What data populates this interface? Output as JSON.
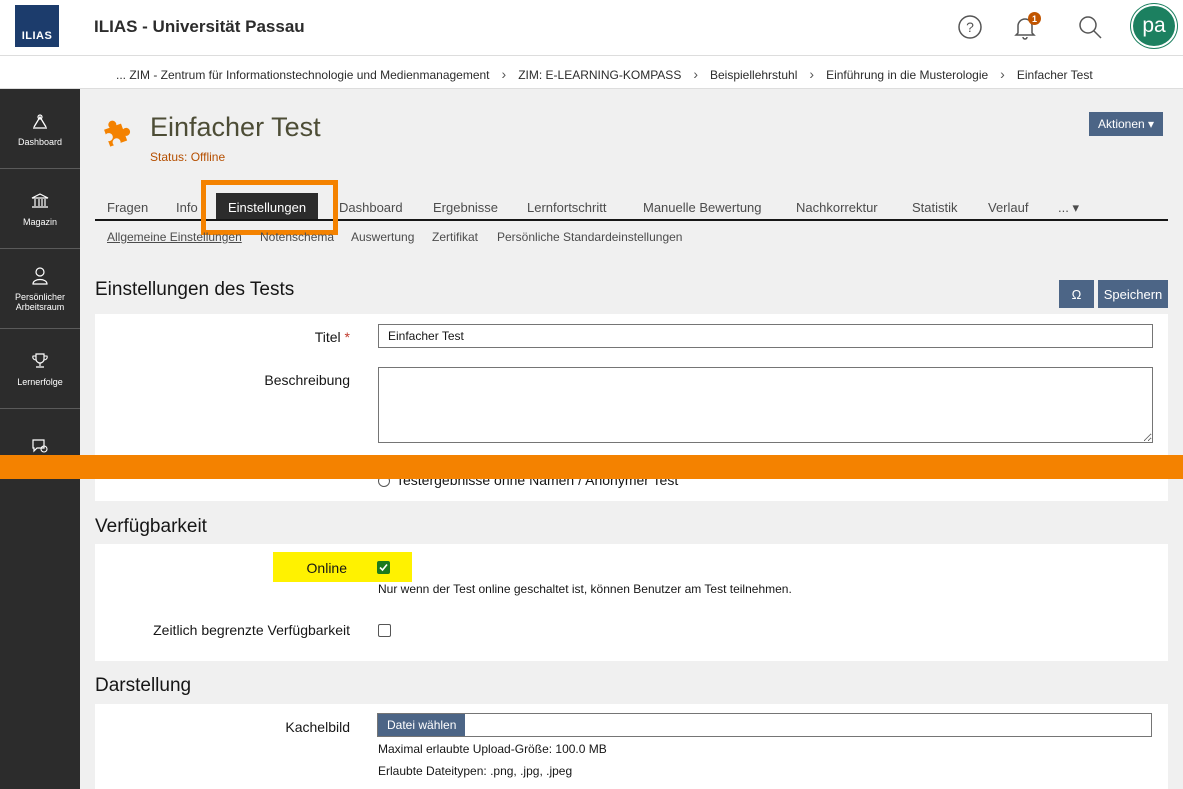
{
  "header": {
    "logo_text": "ILIAS",
    "app_title": "ILIAS - Universität Passau",
    "help_icon": "help-circle-icon",
    "notification_icon": "bell-icon",
    "notification_count": "1",
    "search_icon": "search-icon",
    "avatar_initials": "pa",
    "avatar_color": "#1c8060"
  },
  "breadcrumb": [
    "... ZIM - Zentrum für Informationstechnologie und Medienmanagement",
    "ZIM: E-LEARNING-KOMPASS",
    "Beispiellehrstuhl",
    "Einführung in die Musterologie",
    "Einfacher Test"
  ],
  "sidebar": [
    {
      "label": "Dashboard",
      "icon": "dashboard-icon"
    },
    {
      "label": "Magazin",
      "icon": "magazine-icon"
    },
    {
      "label": "Persönlicher Arbeitsraum",
      "icon": "person-icon"
    },
    {
      "label": "Lernerfolge",
      "icon": "trophy-icon"
    },
    {
      "label": "",
      "icon": "chat-icon"
    }
  ],
  "object": {
    "title": "Einfacher Test",
    "status": "Status: Offline",
    "icon": "puzzle-icon",
    "actions_label": "Aktionen ▾"
  },
  "tabs": [
    "Fragen",
    "Info",
    "Einstellungen",
    "Dashboard",
    "Ergebnisse",
    "Lernfortschritt",
    "Manuelle Bewertung",
    "Nachkorrektur",
    "Statistik",
    "Verlauf",
    "... ▾"
  ],
  "active_tab": "Einstellungen",
  "subtabs": [
    "Allgemeine Einstellungen",
    "Notenschema",
    "Auswertung",
    "Zertifikat",
    "Persönliche Standardeinstellungen"
  ],
  "settings": {
    "section_title": "Einstellungen des Tests",
    "omega_button": "Ω",
    "save_button": "Speichern",
    "title_label": "Titel",
    "title_required": "*",
    "title_value": "Einfacher Test",
    "description_label": "Beschreibung",
    "description_value": "",
    "anonymous_option": "Testergebnisse ohne Namen / Anonymer Test"
  },
  "availability": {
    "section_title": "Verfügbarkeit",
    "online_label": "Online",
    "online_checked": true,
    "online_help": "Nur wenn der Test online geschaltet ist, können Benutzer am Test teilnehmen.",
    "limited_label": "Zeitlich begrenzte Verfügbarkeit",
    "limited_checked": false
  },
  "presentation": {
    "section_title": "Darstellung",
    "tile_label": "Kachelbild",
    "file_button": "Datei wählen",
    "max_size": "Maximal erlaubte Upload-Größe: 100.0 MB",
    "file_types": "Erlaubte Dateitypen: .png, .jpg, .jpeg"
  },
  "colors": {
    "highlight_orange": "#f48200",
    "highlight_yellow": "#fff200",
    "button_blue": "#4c6586",
    "sidebar": "#2c2c2c",
    "logo_blue": "#1c3c6c"
  }
}
